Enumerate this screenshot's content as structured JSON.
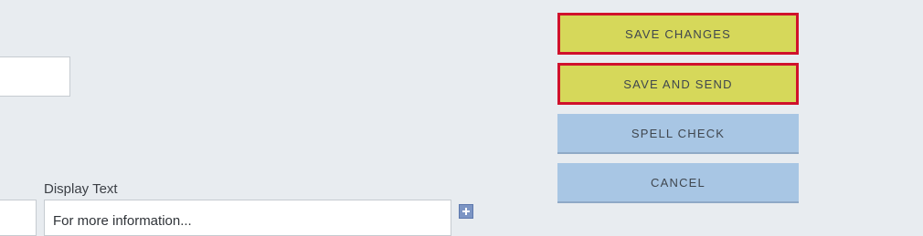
{
  "form": {
    "display_text_label": "Display Text",
    "display_text_value": "For more information..."
  },
  "actions": {
    "save_changes": "SAVE CHANGES",
    "save_and_send": "SAVE AND SEND",
    "spell_check": "SPELL CHECK",
    "cancel": "CANCEL"
  },
  "icons": {
    "add": "plus-square-icon"
  },
  "colors": {
    "background": "#e8ecf0",
    "primary_button": "#d6d85a",
    "primary_button_outline": "#d0112b",
    "secondary_button": "#a8c6e4",
    "add_icon": "#7c95c4"
  }
}
